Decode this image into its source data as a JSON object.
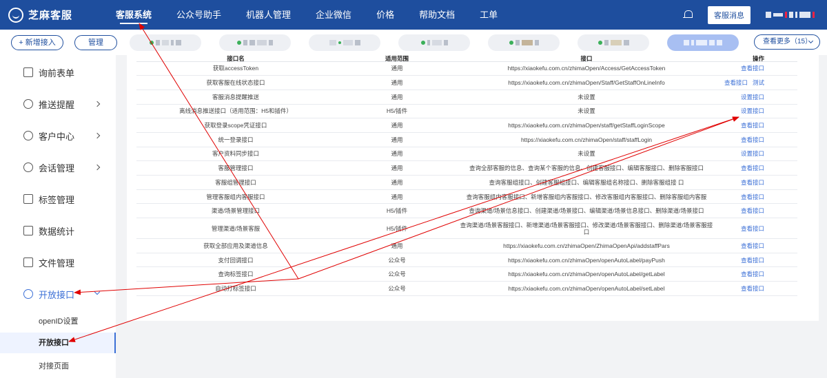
{
  "brand": {
    "name": "芝麻客服"
  },
  "nav": {
    "items": [
      {
        "label": "客服系统",
        "active": true
      },
      {
        "label": "公众号助手",
        "active": false
      },
      {
        "label": "机器人管理",
        "active": false
      },
      {
        "label": "企业微信",
        "active": false
      },
      {
        "label": "价格",
        "active": false
      },
      {
        "label": "帮助文档",
        "active": false
      },
      {
        "label": "工单",
        "active": false
      }
    ],
    "bell_icon": "bell-icon",
    "message_button": "客服消息"
  },
  "channelbar": {
    "add_label": "+ 新增接入",
    "manage_label": "管理",
    "more_label": "查看更多（15）"
  },
  "sidebar": {
    "items": [
      {
        "label": "询前表单",
        "icon": "form-icon",
        "has_arrow": false
      },
      {
        "label": "推送提醒",
        "icon": "bell-icon",
        "has_arrow": true
      },
      {
        "label": "客户中心",
        "icon": "users-icon",
        "has_arrow": true
      },
      {
        "label": "会话管理",
        "icon": "chat-icon",
        "has_arrow": true
      },
      {
        "label": "标签管理",
        "icon": "tag-icon",
        "has_arrow": false
      },
      {
        "label": "数据统计",
        "icon": "chart-icon",
        "has_arrow": false
      },
      {
        "label": "文件管理",
        "icon": "folder-icon",
        "has_arrow": false
      },
      {
        "label": "开放接口",
        "icon": "api-icon",
        "has_arrow": true
      }
    ],
    "subitems": [
      {
        "label": "openID设置",
        "active": false
      },
      {
        "label": "开放接口",
        "active": true
      },
      {
        "label": "对接页面",
        "active": false
      }
    ]
  },
  "table": {
    "headers": [
      "接口名",
      "适用范围",
      "接口",
      "操作"
    ],
    "rows": [
      {
        "name": "获取accessToken",
        "scope": "通用",
        "endpoint": "https://xiaokefu.com.cn/zhimaOpen/Access/GetAccessToken",
        "ops": [
          "查看接口"
        ]
      },
      {
        "name": "获取客服在线状态接口",
        "scope": "通用",
        "endpoint": "https://xiaokefu.com.cn/zhimaOpen/Staff/GetStaffOnLineInfo",
        "ops": [
          "查看接口",
          "测试"
        ]
      },
      {
        "name": "客服消息提醒推送",
        "scope": "通用",
        "endpoint": "未设置",
        "ops": [
          "设置接口"
        ]
      },
      {
        "name": "离线消息推送接口（适用范围：H5和插件）",
        "scope": "H5/插件",
        "endpoint": "未设置",
        "ops": [
          "设置接口"
        ]
      },
      {
        "name": "获取登录scope凭证接口",
        "scope": "通用",
        "endpoint": "https://xiaokefu.com.cn/zhimaOpen/staff/getStaffLoginScope",
        "ops": [
          "查看接口"
        ]
      },
      {
        "name": "统一登录接口",
        "scope": "通用",
        "endpoint": "https://xiaokefu.com.cn/zhimaOpen/staff/staffLogin",
        "ops": [
          "查看接口"
        ]
      },
      {
        "name": "客户资料同步接口",
        "scope": "通用",
        "endpoint": "未设置",
        "ops": [
          "设置接口"
        ]
      },
      {
        "name": "客服管理接口",
        "scope": "通用",
        "endpoint": "查询全部客服的信息、查询某个客服的信息、创建客服接口、编辑客服接口、删除客服接口",
        "ops": [
          "查看接口"
        ]
      },
      {
        "name": "客服组管理接口",
        "scope": "通用",
        "endpoint": "查询客服组接口、创建客服组接口、编辑客服组名称接口、删除客服组接 口",
        "ops": [
          "查看接口"
        ]
      },
      {
        "name": "管理客服组内客服接口",
        "scope": "通用",
        "endpoint": "查询客服组内客服接口、新增客服组内客服接口、修改客服组内客服接口、删除客服组内客服",
        "ops": [
          "查看接口"
        ]
      },
      {
        "name": "渠道/场景管理接口",
        "scope": "H5/插件",
        "endpoint": "查询渠道/场景信息接口、创建渠道/场景接口、编辑渠道/场景信息接口、删除渠道/场景接口",
        "ops": [
          "查看接口"
        ]
      },
      {
        "name": "管理渠道/场景客服",
        "scope": "H5/插件",
        "endpoint": "查询渠道/场景客服接口、新增渠道/场景客服接口、修改渠道/场景客服接口、删除渠道/场景客服接口",
        "ops": [
          "查看接口"
        ],
        "tall": true
      },
      {
        "name": "获取全部应用及渠道信息",
        "scope": "通用",
        "endpoint": "https://xiaokefu.com.cn/zhimaOpen/ZhimaOpenApi/addstaffPars",
        "ops": [
          "查看接口"
        ]
      },
      {
        "name": "支付回调接口",
        "scope": "公众号",
        "endpoint": "https://xiaokefu.com.cn/zhimaOpen/openAutoLabel/payPush",
        "ops": [
          "查看接口"
        ]
      },
      {
        "name": "查询标签接口",
        "scope": "公众号",
        "endpoint": "https://xiaokefu.com.cn/zhimaOpen/openAutoLabel/getLabel",
        "ops": [
          "查看接口"
        ]
      },
      {
        "name": "自动打标签接口",
        "scope": "公众号",
        "endpoint": "https://xiaokefu.com.cn/zhimaOpen/openAutoLabel/setLabel",
        "ops": [
          "查看接口"
        ]
      }
    ]
  },
  "colors": {
    "nav_bg": "#1e4e9e",
    "accent": "#3b6fd6",
    "annotation": "#e00000"
  }
}
